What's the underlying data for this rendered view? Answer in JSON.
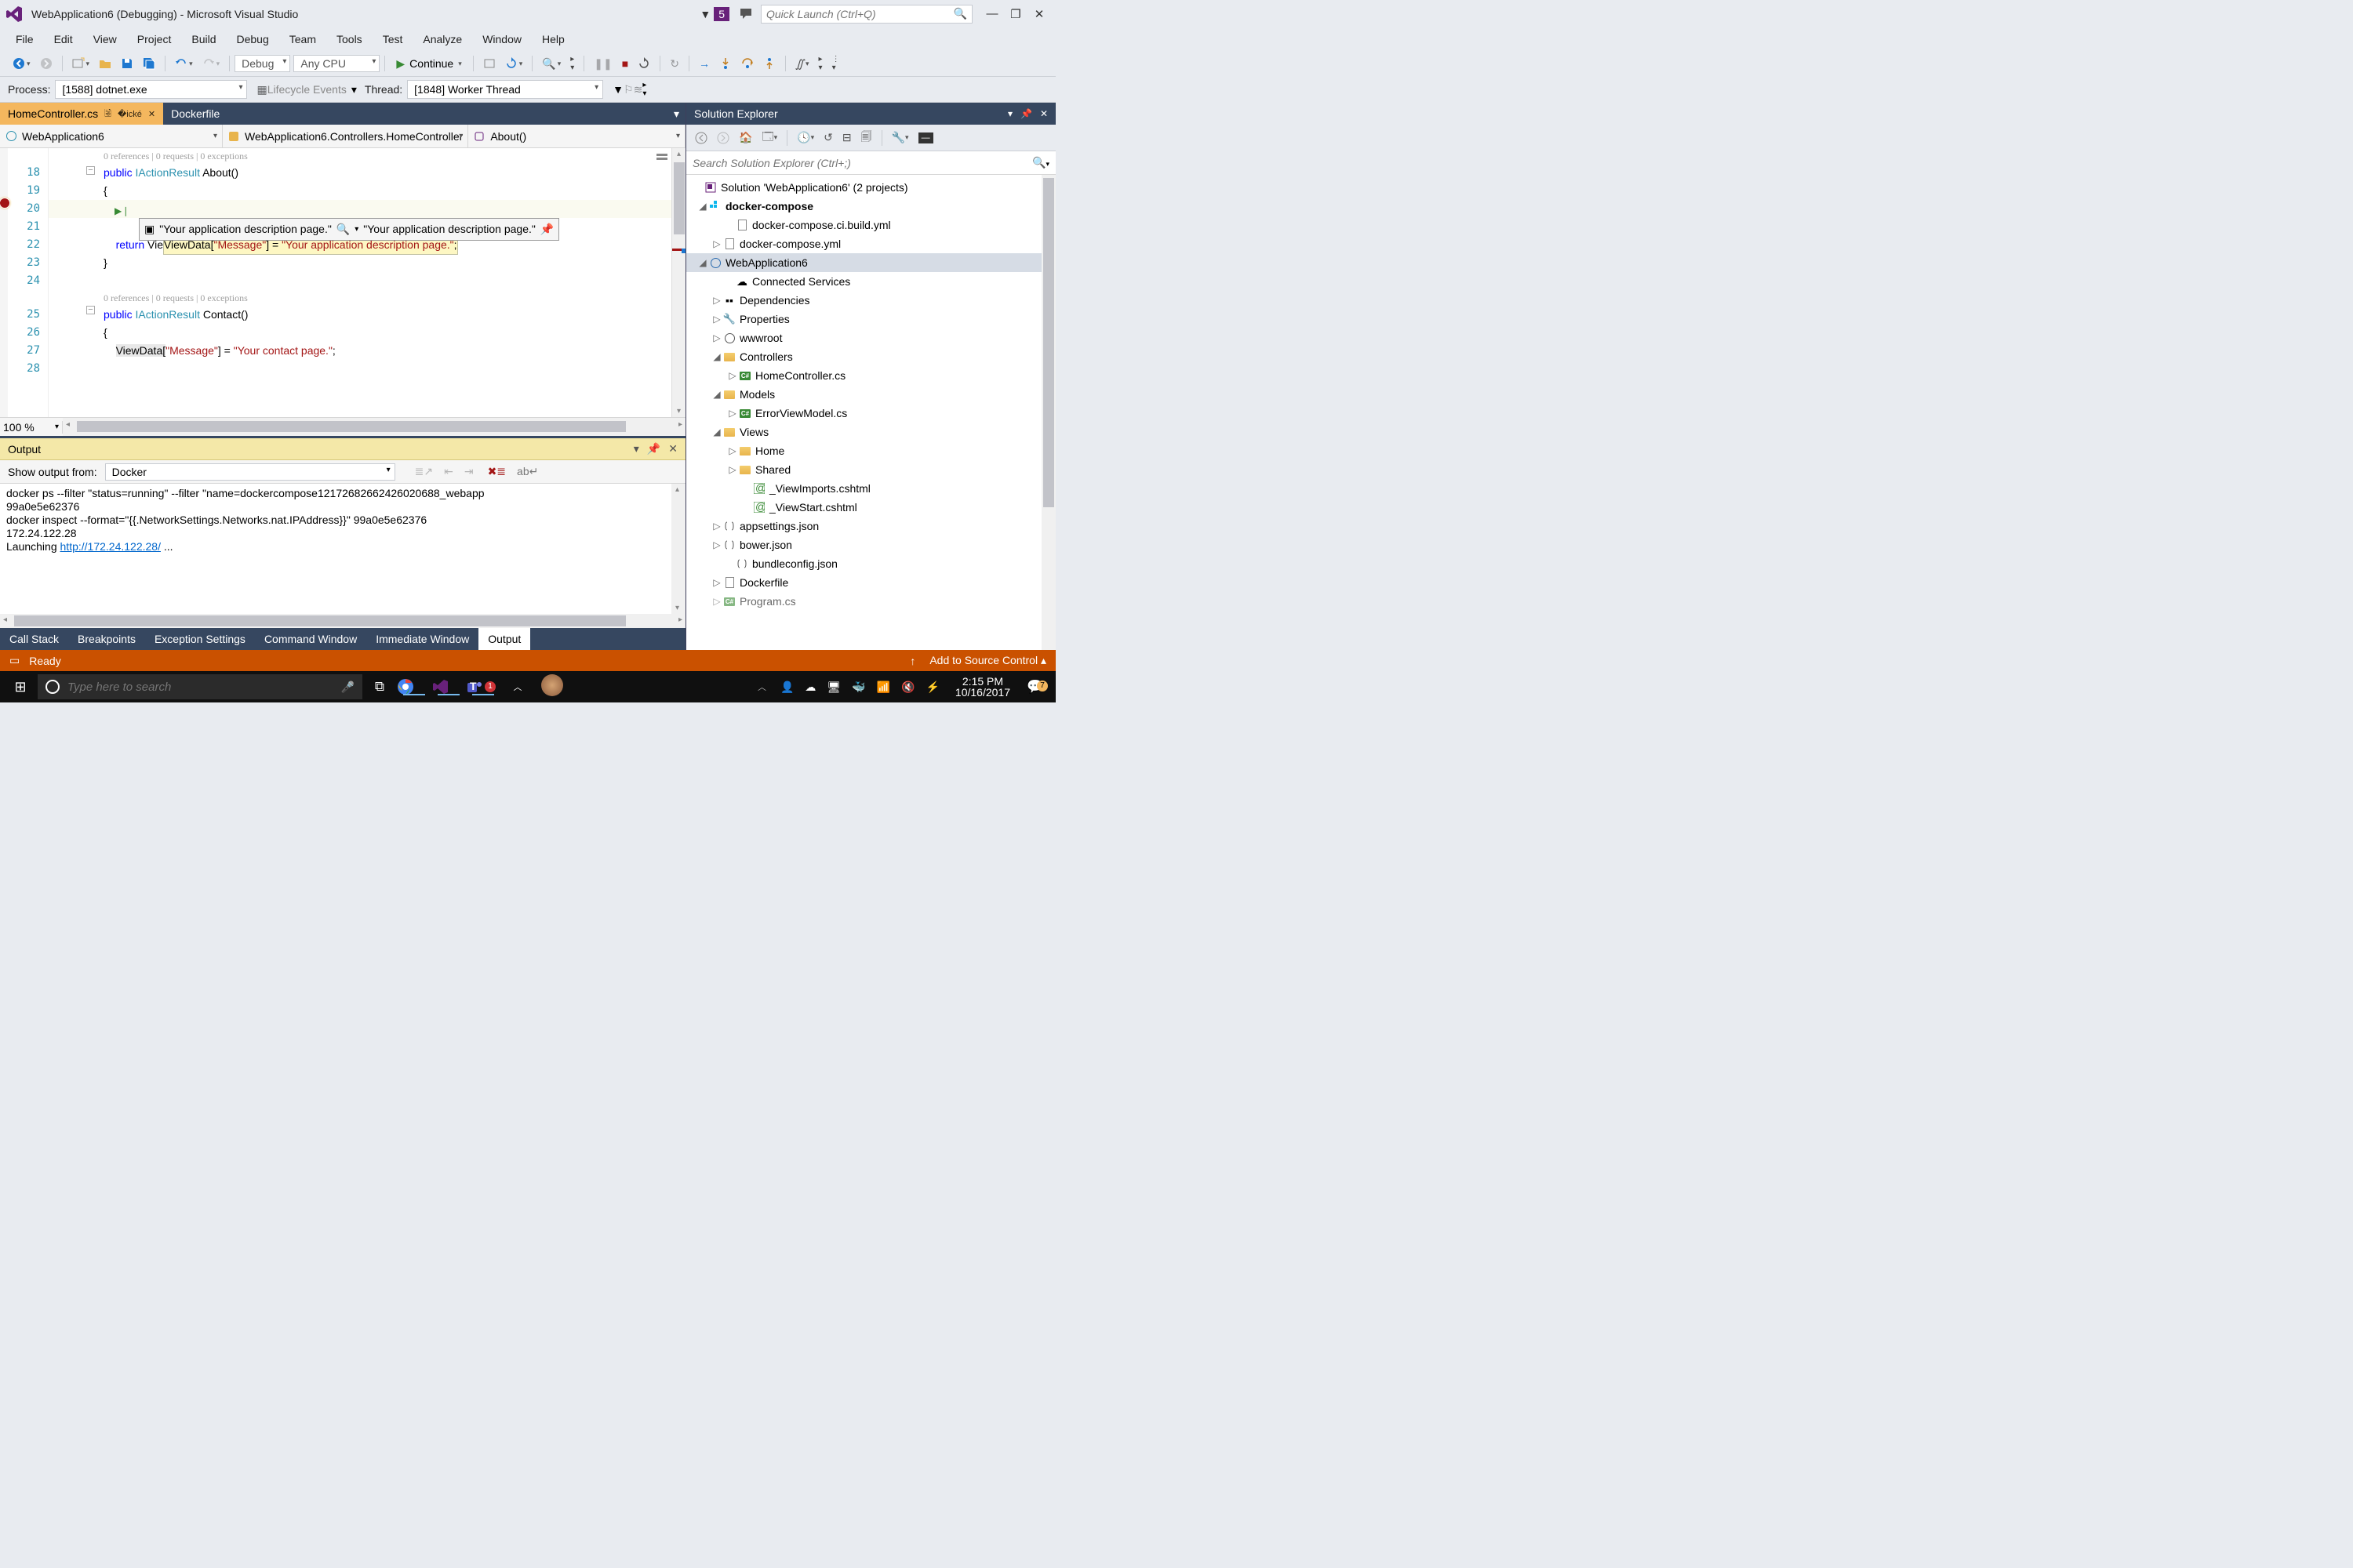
{
  "titlebar": {
    "title": "WebApplication6 (Debugging) - Microsoft Visual Studio",
    "notifications_count": "5",
    "quick_launch_placeholder": "Quick Launch (Ctrl+Q)"
  },
  "menubar": [
    "File",
    "Edit",
    "View",
    "Project",
    "Build",
    "Debug",
    "Team",
    "Tools",
    "Test",
    "Analyze",
    "Window",
    "Help"
  ],
  "toolbar1": {
    "config": "Debug",
    "platform": "Any CPU",
    "continue": "Continue"
  },
  "toolbar2": {
    "process_label": "Process:",
    "process_value": "[1588] dotnet.exe",
    "lifecycle": "Lifecycle Events",
    "thread_label": "Thread:",
    "thread_value": "[1848] Worker Thread"
  },
  "doc_tabs": {
    "active": "HomeController.cs",
    "inactive": "Dockerfile"
  },
  "navbar": {
    "project": "WebApplication6",
    "class": "WebApplication6.Controllers.HomeController",
    "member": "About()"
  },
  "editor": {
    "lines": [
      "18",
      "19",
      "20",
      "21",
      "22",
      "23",
      "24",
      "25",
      "26",
      "27",
      "28"
    ],
    "codelens1": "0 references | 0 requests | 0 exceptions",
    "l18_kw": "public",
    "l18_type": "IActionResult",
    "l18_name": " About()",
    "l19": "{",
    "l20_pre": "ViewData[",
    "l20_key": "\"Message\"",
    "l20_mid": "] = ",
    "l20_str": "\"Your application description page.\"",
    "l20_end": ";",
    "datatip_left": "\"Your application description page.\"",
    "datatip_right": "\"Your application description page.\"",
    "l22_kw": "return",
    "l22_rest": " View();",
    "l23": "}",
    "codelens2": "0 references | 0 requests | 0 exceptions",
    "l25_kw": "public",
    "l25_type": "IActionResult",
    "l25_name": " Contact()",
    "l26": "{",
    "l27_pre": "ViewData[",
    "l27_key": "\"Message\"",
    "l27_mid": "] = ",
    "l27_str": "\"Your contact page.\"",
    "l27_end": ";",
    "zoom": "100 %"
  },
  "output": {
    "title": "Output",
    "from_label": "Show output from:",
    "from_value": "Docker",
    "line1": "docker ps --filter \"status=running\" --filter \"name=dockercompose12172682662426020688_webapp",
    "line2": "99a0e5e62376",
    "line3": "docker inspect --format=\"{{.NetworkSettings.Networks.nat.IPAddress}}\" 99a0e5e62376",
    "line4": "172.24.122.28",
    "line5_pre": "Launching ",
    "line5_url": "http://172.24.122.28/",
    "line5_post": " ..."
  },
  "bottom_tabs": [
    "Call Stack",
    "Breakpoints",
    "Exception Settings",
    "Command Window",
    "Immediate Window",
    "Output"
  ],
  "solexp": {
    "title": "Solution Explorer",
    "search_placeholder": "Search Solution Explorer (Ctrl+;)",
    "solution": "Solution 'WebApplication6' (2 projects)",
    "items": {
      "docker_compose": "docker-compose",
      "ci_build": "docker-compose.ci.build.yml",
      "compose_yml": "docker-compose.yml",
      "proj": "WebApplication6",
      "connected": "Connected Services",
      "deps": "Dependencies",
      "props": "Properties",
      "wwwroot": "wwwroot",
      "controllers": "Controllers",
      "homecontroller": "HomeController.cs",
      "models": "Models",
      "errorvm": "ErrorViewModel.cs",
      "views": "Views",
      "home": "Home",
      "shared": "Shared",
      "viewimports": "_ViewImports.cshtml",
      "viewstart": "_ViewStart.cshtml",
      "appsettings": "appsettings.json",
      "bower": "bower.json",
      "bundle": "bundleconfig.json",
      "dockerfile": "Dockerfile",
      "program": "Program.cs"
    }
  },
  "statusbar": {
    "ready": "Ready",
    "source_control": "Add to Source Control"
  },
  "taskbar": {
    "search_placeholder": "Type here to search",
    "time": "2:15 PM",
    "date": "10/16/2017",
    "teams_badge": "1",
    "action_badge": "7"
  }
}
